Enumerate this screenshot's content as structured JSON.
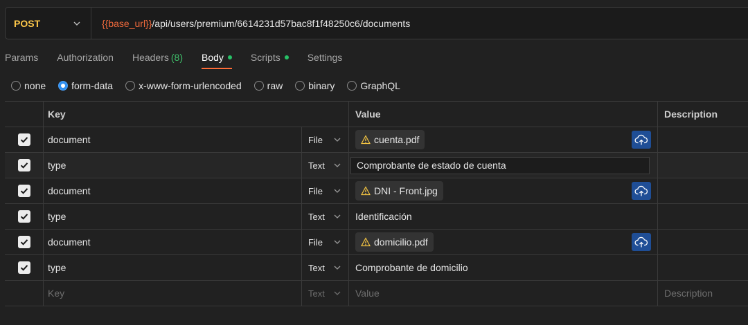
{
  "request": {
    "method": "POST",
    "url_var": "{{base_url}}",
    "url_path": "/api/users/premium/6614231d57bac8f1f48250c6/documents"
  },
  "tabs": [
    {
      "label": "Params",
      "active": false
    },
    {
      "label": "Authorization",
      "active": false
    },
    {
      "label": "Headers",
      "count": "(8)",
      "active": false
    },
    {
      "label": "Body",
      "dot": true,
      "active": true
    },
    {
      "label": "Scripts",
      "dot": true,
      "active": false
    },
    {
      "label": "Settings",
      "active": false
    }
  ],
  "body_types": [
    {
      "label": "none",
      "selected": false
    },
    {
      "label": "form-data",
      "selected": true
    },
    {
      "label": "x-www-form-urlencoded",
      "selected": false
    },
    {
      "label": "raw",
      "selected": false
    },
    {
      "label": "binary",
      "selected": false
    },
    {
      "label": "GraphQL",
      "selected": false
    }
  ],
  "table": {
    "headers": {
      "key": "Key",
      "value": "Value",
      "description": "Description"
    },
    "rows": [
      {
        "key": "document",
        "type": "File",
        "value": "cuenta.pdf",
        "kind": "file"
      },
      {
        "key": "type",
        "type": "Text",
        "value": "Comprobante de estado de cuenta",
        "kind": "text-focused"
      },
      {
        "key": "document",
        "type": "File",
        "value": "DNI - Front.jpg",
        "kind": "file"
      },
      {
        "key": "type",
        "type": "Text",
        "value": "Identificación",
        "kind": "text"
      },
      {
        "key": "document",
        "type": "File",
        "value": "domicilio.pdf",
        "kind": "file"
      },
      {
        "key": "type",
        "type": "Text",
        "value": "Comprobante de domicilio",
        "kind": "text"
      }
    ],
    "new_row": {
      "key_placeholder": "Key",
      "type": "Text",
      "value_placeholder": "Value",
      "description_placeholder": "Description"
    }
  },
  "colors": {
    "method": "#ffc94a",
    "url_var": "#f06a3c",
    "tab_underline": "#ff6c37",
    "dot": "#27c267",
    "radio_selected": "#2f8ff0",
    "upload_button": "#1f4e96",
    "warning": "#f5c542"
  },
  "icons": {
    "method_dropdown": "chevron-down-icon",
    "type_dropdown": "chevron-down-icon",
    "file_warning": "warning-icon",
    "upload": "cloud-upload-icon",
    "checkbox": "check-icon"
  }
}
